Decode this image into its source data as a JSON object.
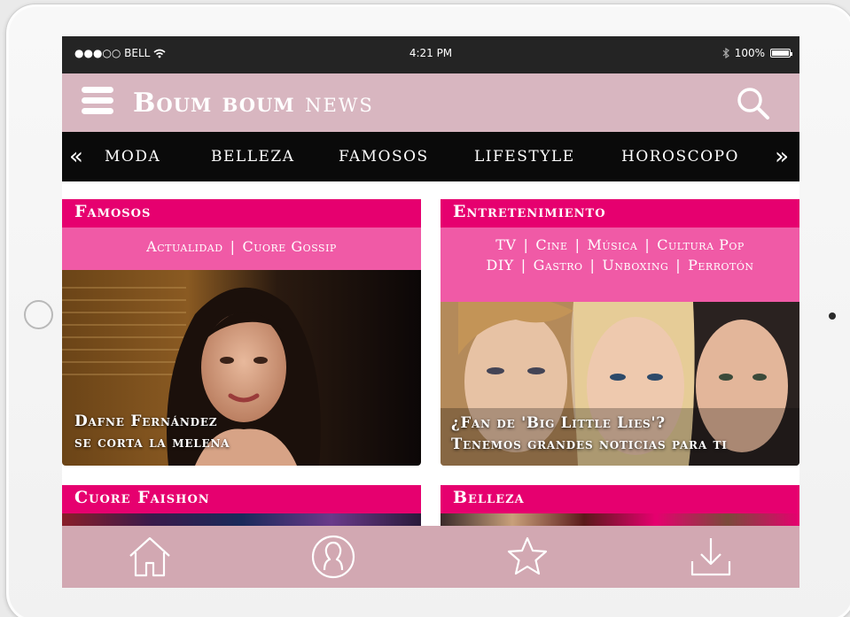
{
  "status_bar": {
    "carrier": "●●●○○ BELL",
    "time": "4:21 PM",
    "battery": "100%"
  },
  "header": {
    "logo_main": "Boum boum",
    "logo_suffix": "news"
  },
  "category_nav": {
    "items": [
      "MODA",
      "BELLEZA",
      "FAMOSOS",
      "LIFESTYLE",
      "HOROSCOPO"
    ]
  },
  "cards": {
    "famosos": {
      "title": "Famosos",
      "subcats": [
        "Actualidad",
        "Cuore Gossip"
      ],
      "caption_line1": "Dafne Fernández",
      "caption_line2": "se corta la melena"
    },
    "entretenimiento": {
      "title": "Entretenimiento",
      "subcats_row1": [
        "TV",
        "Cine",
        "Música",
        "Cultura Pop"
      ],
      "subcats_row2": [
        "DIY",
        "Gastro",
        "Unboxing",
        "Perrotón"
      ],
      "caption_line1": "¿Fan de  'Big Little Lies'?",
      "caption_line2": "Tenemos grandes noticias para ti"
    },
    "cuore_faishon": {
      "title": "Cuore Faishon"
    },
    "belleza": {
      "title": "Belleza"
    }
  },
  "tab_bar": {
    "icons": [
      "home-icon",
      "profile-icon",
      "star-icon",
      "download-icon"
    ]
  },
  "colors": {
    "header_bg": "#d8b6c0",
    "card_title_bg": "#e6006f",
    "card_sub_bg": "#f05aa6",
    "nav_bg": "#0a0a0a",
    "tabbar_bg": "#d2a8b2"
  }
}
